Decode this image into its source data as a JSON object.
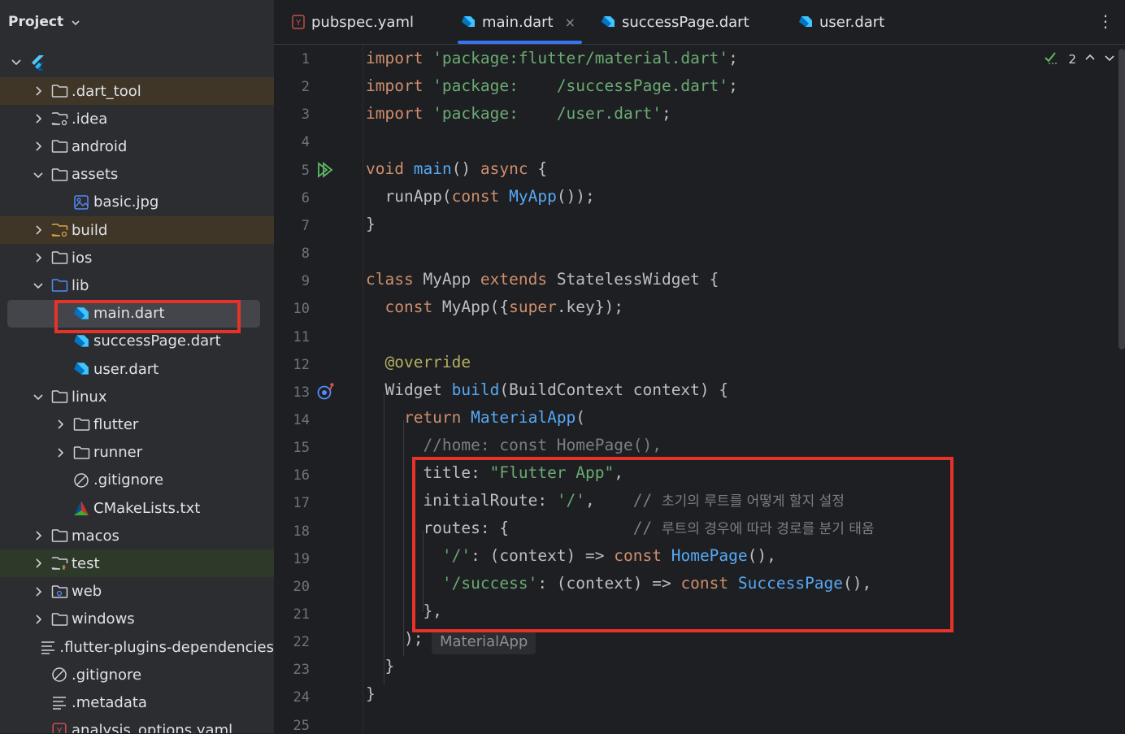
{
  "project_panel": {
    "title": "Project",
    "items": [
      {
        "label": ".dart_tool",
        "arrow": "right",
        "icon": "folder"
      },
      {
        "label": ".idea",
        "arrow": "right",
        "icon": "folder-config"
      },
      {
        "label": "android",
        "arrow": "right",
        "icon": "folder"
      },
      {
        "label": "assets",
        "arrow": "down",
        "icon": "folder"
      },
      {
        "label": "basic.jpg",
        "arrow": "",
        "icon": "image"
      },
      {
        "label": "build",
        "arrow": "right",
        "icon": "folder-excluded"
      },
      {
        "label": "ios",
        "arrow": "right",
        "icon": "folder"
      },
      {
        "label": "lib",
        "arrow": "down",
        "icon": "folder-source"
      },
      {
        "label": "main.dart",
        "arrow": "",
        "icon": "dart"
      },
      {
        "label": "successPage.dart",
        "arrow": "",
        "icon": "dart"
      },
      {
        "label": "user.dart",
        "arrow": "",
        "icon": "dart"
      },
      {
        "label": "linux",
        "arrow": "down",
        "icon": "folder"
      },
      {
        "label": "flutter",
        "arrow": "right",
        "icon": "folder"
      },
      {
        "label": "runner",
        "arrow": "right",
        "icon": "folder"
      },
      {
        "label": ".gitignore",
        "arrow": "",
        "icon": "gitignore"
      },
      {
        "label": "CMakeLists.txt",
        "arrow": "",
        "icon": "cmake"
      },
      {
        "label": "macos",
        "arrow": "right",
        "icon": "folder"
      },
      {
        "label": "test",
        "arrow": "right",
        "icon": "folder-test"
      },
      {
        "label": "web",
        "arrow": "right",
        "icon": "folder-web"
      },
      {
        "label": "windows",
        "arrow": "right",
        "icon": "folder"
      },
      {
        "label": ".flutter-plugins-dependencies",
        "arrow": "",
        "icon": "text-file"
      },
      {
        "label": ".gitignore",
        "arrow": "",
        "icon": "gitignore"
      },
      {
        "label": ".metadata",
        "arrow": "",
        "icon": "text-file"
      },
      {
        "label": "analysis_options.yaml",
        "arrow": "",
        "icon": "yaml"
      }
    ]
  },
  "tabs": [
    {
      "label": "pubspec.yaml",
      "icon": "yaml"
    },
    {
      "label": "main.dart",
      "icon": "dart",
      "active": true
    },
    {
      "label": "successPage.dart",
      "icon": "dart"
    },
    {
      "label": "user.dart",
      "icon": "dart"
    }
  ],
  "tab_close_glyph": "×",
  "tab_more_glyph": "⋮",
  "inspection_count": "2",
  "line_numbers": [
    "1",
    "2",
    "3",
    "4",
    "5",
    "6",
    "7",
    "8",
    "9",
    "10",
    "11",
    "12",
    "13",
    "14",
    "15",
    "16",
    "17",
    "18",
    "19",
    "20",
    "21",
    "22",
    "23",
    "24",
    "25"
  ],
  "code": {
    "l1": {
      "a": "import",
      "b": " 'package:flutter/material.dart'",
      "c": ";"
    },
    "l2": {
      "a": "import",
      "b": " 'package:    /successPage.dart'",
      "c": ";"
    },
    "l3": {
      "a": "import",
      "b": " 'package:    /user.dart'",
      "c": ";"
    },
    "l5": {
      "a": "void",
      "b": "main",
      "c": "() ",
      "d": "async",
      "e": " {"
    },
    "l6": {
      "a": "  runApp(",
      "b": "const",
      "c": " ",
      "d": "MyApp",
      "e": "());"
    },
    "l7": {
      "a": "}"
    },
    "l9": {
      "a": "class",
      "b": " MyApp ",
      "c": "extends",
      "d": " StatelessWidget {"
    },
    "l10": {
      "a": "  const",
      "b": " MyApp({",
      "c": "super",
      "d": ".key});"
    },
    "l12": {
      "a": "  @override"
    },
    "l13": {
      "a": "  Widget ",
      "b": "build",
      "c": "(BuildContext context) {"
    },
    "l14": {
      "a": "    return",
      "b": " ",
      "c": "MaterialApp",
      "d": "("
    },
    "l15": {
      "a": "      //home: const HomePage(),"
    },
    "l16": {
      "a": "      title: ",
      "b": "\"Flutter App\"",
      "c": ","
    },
    "l17": {
      "a": "      initialRoute: ",
      "b": "'/'",
      "c": ",    ",
      "d": "// ",
      "e": "초기의 루트를 어떻게 할지 설정"
    },
    "l18": {
      "a": "      routes: {             ",
      "d": "// ",
      "e": "루트의 경우에 따라 경로를 분기 태움"
    },
    "l19": {
      "a": "        ",
      "b": "'/'",
      "c": ": (context) => ",
      "d": "const",
      "e": " ",
      "f": "HomePage",
      "g": "(),"
    },
    "l20": {
      "a": "        ",
      "b": "'/success'",
      "c": ": (context) => ",
      "d": "const",
      "e": " ",
      "f": "SuccessPage",
      "g": "(),"
    },
    "l21": {
      "a": "      },"
    },
    "l22": {
      "a": "    );"
    },
    "l23": {
      "a": "  }"
    },
    "l24": {
      "a": "}"
    }
  },
  "inlay_hint": "MaterialApp",
  "colors": {
    "keyword": "#cf8e6d",
    "string": "#6aab73",
    "function": "#56a8f5",
    "annotation_box": "#e5332a",
    "selection": "#43454a"
  }
}
